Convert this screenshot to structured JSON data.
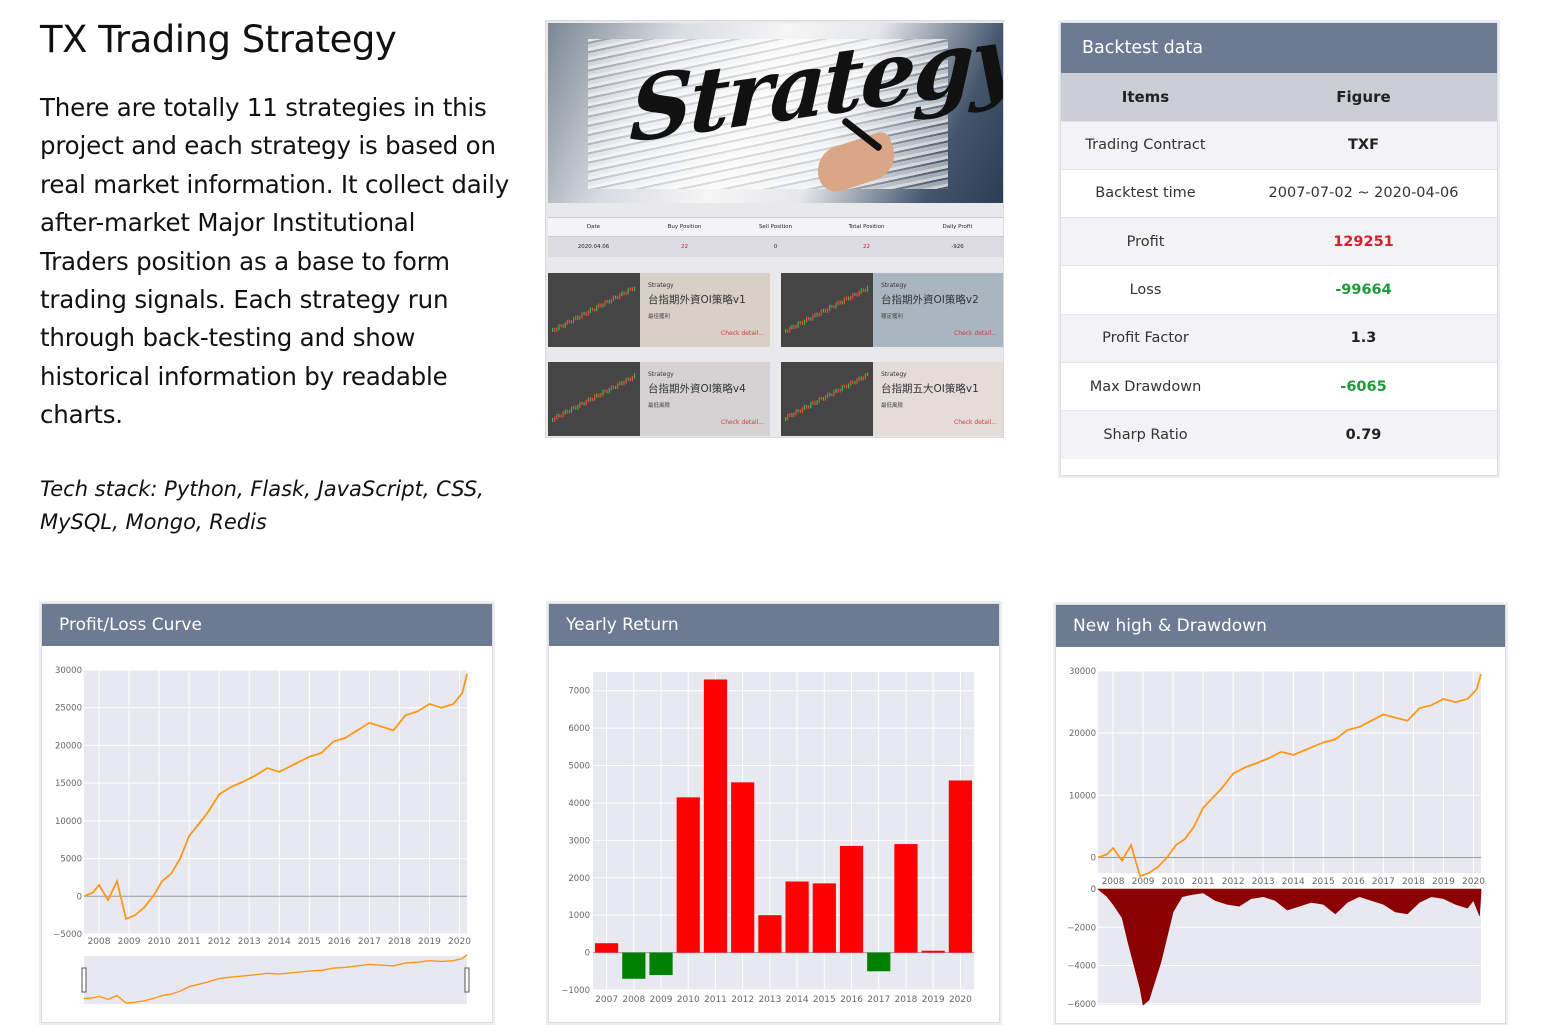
{
  "intro": {
    "title": "TX Trading Strategy",
    "description": "There are totally 11 strategies in this project and each strategy is based on real market information. It collect daily after-market Major Institutional Traders position as a base to form trading signals. Each strategy run through back-testing and show historical information by readable charts.",
    "tech_stack": "Tech stack: Python, Flask, JavaScript, CSS, MySQL, Mongo, Redis"
  },
  "screenshot": {
    "hero_text": "Strategy",
    "table": {
      "headers": [
        "Date",
        "Buy Position",
        "Sell Position",
        "Total Position",
        "Daily Profit"
      ],
      "row": [
        "2020.04.06",
        "22",
        "0",
        "22",
        "-926"
      ]
    },
    "cards": [
      {
        "label": "Strategy",
        "name": "台指期外資OI策略v1",
        "sub": "最佳獲利",
        "link": "Check detail...",
        "bg": "#d8cfc6"
      },
      {
        "label": "Strategy",
        "name": "台指期外資OI策略v2",
        "sub": "穩定獲利",
        "link": "Check detail...",
        "bg": "#a9b6c0"
      },
      {
        "label": "Strategy",
        "name": "台指期外資OI策略v4",
        "sub": "最低風險",
        "link": "Check detail...",
        "bg": "#d4d2d2"
      },
      {
        "label": "Strategy",
        "name": "台指期五大OI策略v1",
        "sub": "最低風險",
        "link": "Check detail...",
        "bg": "#e4dcd8"
      }
    ]
  },
  "backtest": {
    "title": "Backtest data",
    "headers": [
      "Items",
      "Figure"
    ],
    "rows": [
      {
        "item": "Trading Contract",
        "value": "TXF",
        "tone": "normal"
      },
      {
        "item": "Backtest time",
        "value": "2007-07-02 ~ 2020-04-06",
        "tone": "plain"
      },
      {
        "item": "Profit",
        "value": "129251",
        "tone": "pos"
      },
      {
        "item": "Loss",
        "value": "-99664",
        "tone": "neg"
      },
      {
        "item": "Profit Factor",
        "value": "1.3",
        "tone": "normal"
      },
      {
        "item": "Max Drawdown",
        "value": "-6065",
        "tone": "neg"
      },
      {
        "item": "Sharp Ratio",
        "value": "0.79",
        "tone": "normal"
      }
    ]
  },
  "colors": {
    "positive": "#ff0000",
    "negative": "#008000",
    "line": "#ff9618",
    "drawdown": "#8b0000",
    "header": "#6c7a92"
  },
  "chart_data": [
    {
      "type": "line",
      "title": "Profit/Loss Curve",
      "x_ticks": [
        "2008",
        "2009",
        "2010",
        "2011",
        "2012",
        "2013",
        "2014",
        "2015",
        "2016",
        "2017",
        "2018",
        "2019",
        "2020"
      ],
      "y_ticks": [
        "30000",
        "25000",
        "20000",
        "15000",
        "10000",
        "5000",
        "0",
        "−5000"
      ],
      "ylim": [
        -5000,
        30000
      ],
      "x": [
        2007.5,
        2007.8,
        2008.0,
        2008.3,
        2008.6,
        2008.9,
        2009.2,
        2009.5,
        2009.8,
        2010.1,
        2010.4,
        2010.7,
        2011.0,
        2011.3,
        2011.6,
        2012.0,
        2012.4,
        2012.8,
        2013.2,
        2013.6,
        2014.0,
        2014.5,
        2015.0,
        2015.4,
        2015.8,
        2016.2,
        2016.6,
        2017.0,
        2017.4,
        2017.8,
        2018.2,
        2018.6,
        2019.0,
        2019.4,
        2019.8,
        2020.1,
        2020.25
      ],
      "y": [
        0,
        500,
        1500,
        -500,
        2000,
        -3000,
        -2500,
        -1500,
        0,
        2000,
        3000,
        5000,
        8000,
        9500,
        11000,
        13500,
        14500,
        15200,
        16000,
        17000,
        16500,
        17500,
        18500,
        19000,
        20500,
        21000,
        22000,
        23000,
        22500,
        22000,
        24000,
        24500,
        25500,
        25000,
        25500,
        27000,
        29500
      ],
      "grid": true,
      "has_range_slider": true
    },
    {
      "type": "bar",
      "title": "Yearly Return",
      "categories": [
        "2007",
        "2008",
        "2009",
        "2010",
        "2011",
        "2012",
        "2013",
        "2014",
        "2015",
        "2016",
        "2017",
        "2018",
        "2019",
        "2020"
      ],
      "values": [
        250,
        -700,
        -600,
        4150,
        7300,
        4550,
        1000,
        1900,
        1850,
        2850,
        -500,
        2900,
        50,
        4600
      ],
      "y_ticks": [
        "7000",
        "6000",
        "5000",
        "4000",
        "3000",
        "2000",
        "1000",
        "0",
        "−1000"
      ],
      "ylim": [
        -1000,
        7500
      ],
      "grid": true
    },
    {
      "type": "line",
      "title": "New high & Drawdown",
      "x_ticks": [
        "2008",
        "2009",
        "2010",
        "2011",
        "2012",
        "2013",
        "2014",
        "2015",
        "2016",
        "2017",
        "2018",
        "2019",
        "2020"
      ],
      "y_ticks_top": [
        "30000",
        "20000",
        "10000",
        "0"
      ],
      "y_ticks_bottom": [
        "0",
        "−2000",
        "−4000",
        "−6000"
      ],
      "ylim_top": [
        -2500,
        30000
      ],
      "ylim_bottom": [
        -6065,
        0
      ],
      "x": [
        2007.5,
        2007.8,
        2008.0,
        2008.3,
        2008.6,
        2008.9,
        2009.2,
        2009.5,
        2009.8,
        2010.1,
        2010.4,
        2010.7,
        2011.0,
        2011.3,
        2011.6,
        2012.0,
        2012.4,
        2012.8,
        2013.2,
        2013.6,
        2014.0,
        2014.5,
        2015.0,
        2015.4,
        2015.8,
        2016.2,
        2016.6,
        2017.0,
        2017.4,
        2017.8,
        2018.2,
        2018.6,
        2019.0,
        2019.4,
        2019.8,
        2020.1,
        2020.25
      ],
      "y": [
        0,
        500,
        1500,
        -500,
        2000,
        -3000,
        -2500,
        -1500,
        0,
        2000,
        3000,
        5000,
        8000,
        9500,
        11000,
        13500,
        14500,
        15200,
        16000,
        17000,
        16500,
        17500,
        18500,
        19000,
        20500,
        21000,
        22000,
        23000,
        22500,
        22000,
        24000,
        24500,
        25500,
        25000,
        25500,
        27000,
        29500
      ],
      "drawdown_x": [
        2007.5,
        2007.8,
        2008.0,
        2008.3,
        2008.5,
        2008.7,
        2008.9,
        2009.0,
        2009.2,
        2009.4,
        2009.6,
        2009.8,
        2010.0,
        2010.3,
        2010.6,
        2011.0,
        2011.4,
        2011.8,
        2012.2,
        2012.6,
        2013.0,
        2013.4,
        2013.8,
        2014.2,
        2014.6,
        2015.0,
        2015.4,
        2015.8,
        2016.2,
        2016.6,
        2017.0,
        2017.4,
        2017.8,
        2018.2,
        2018.6,
        2019.0,
        2019.4,
        2019.8,
        2020.0,
        2020.2,
        2020.25
      ],
      "drawdown": [
        0,
        -400,
        -800,
        -1500,
        -2800,
        -4000,
        -5200,
        -6065,
        -5800,
        -4800,
        -3800,
        -2500,
        -1200,
        -400,
        -300,
        -200,
        -600,
        -800,
        -900,
        -500,
        -400,
        -600,
        -1100,
        -900,
        -700,
        -800,
        -1300,
        -700,
        -400,
        -600,
        -800,
        -1200,
        -1300,
        -700,
        -400,
        -500,
        -800,
        -1000,
        -600,
        -1400,
        -200
      ],
      "grid": true
    }
  ]
}
